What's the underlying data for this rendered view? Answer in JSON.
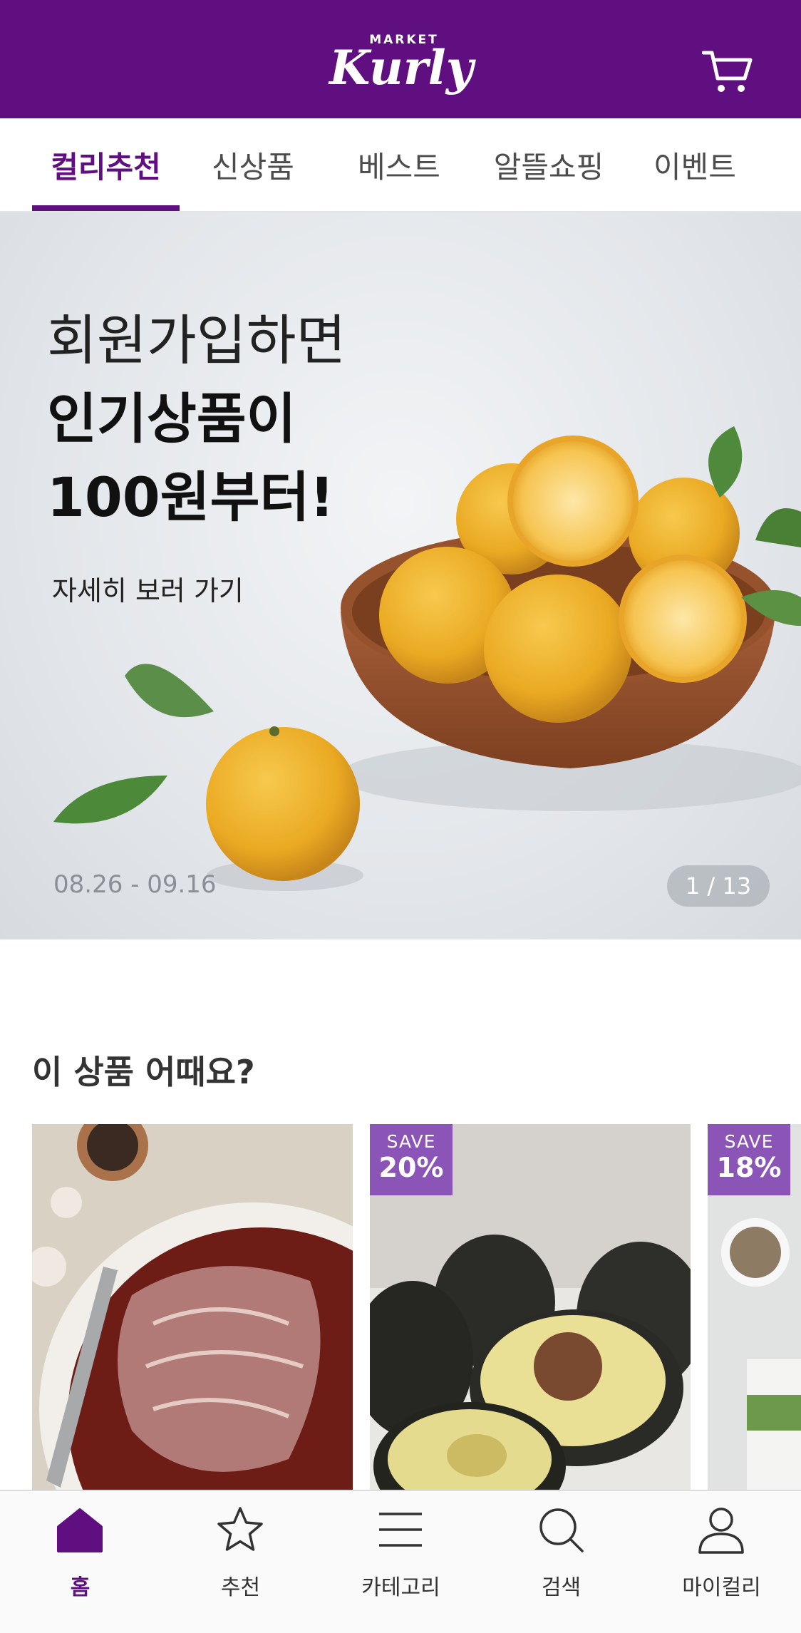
{
  "header": {
    "logo_small": "MARKET",
    "logo_main": "Kurly",
    "brand_color": "#5f0f80",
    "cart_icon": "cart-icon"
  },
  "tabs": [
    {
      "label": "컬리추천",
      "active": true
    },
    {
      "label": "신상품",
      "active": false
    },
    {
      "label": "베스트",
      "active": false
    },
    {
      "label": "알뜰쇼핑",
      "active": false
    },
    {
      "label": "이벤트",
      "active": false
    }
  ],
  "banner": {
    "line1": "회원가입하면",
    "line2": "인기상품이",
    "line3": "100원부터!",
    "link": "자세히 보러 가기",
    "date_range": "08.26 - 09.16",
    "counter": "1 / 13"
  },
  "recommend": {
    "title": "이 상품 어때요?",
    "products": [
      {
        "image": "marinated-pork",
        "save_label": "",
        "discount": ""
      },
      {
        "image": "avocado",
        "save_label": "SAVE",
        "discount": "20%"
      },
      {
        "image": "vegetable-flakes",
        "save_label": "SAVE",
        "discount": "18%"
      }
    ]
  },
  "bottom_nav": [
    {
      "label": "홈",
      "icon": "home-icon",
      "active": true
    },
    {
      "label": "추천",
      "icon": "star-icon",
      "active": false
    },
    {
      "label": "카테고리",
      "icon": "menu-icon",
      "active": false
    },
    {
      "label": "검색",
      "icon": "search-icon",
      "active": false
    },
    {
      "label": "마이컬리",
      "icon": "user-icon",
      "active": false
    }
  ]
}
